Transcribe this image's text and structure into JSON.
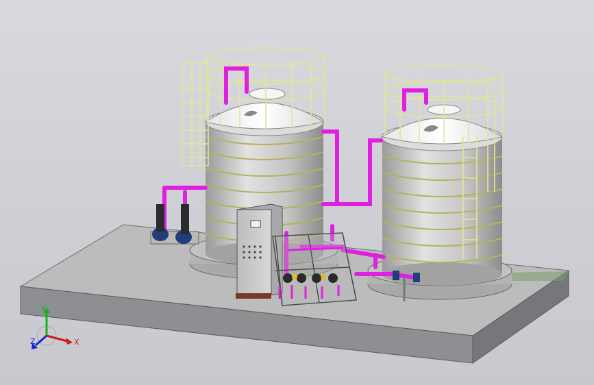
{
  "viewport": {
    "background": "#cfd0d6",
    "model_colors": {
      "slab_top": "#bcbcbc",
      "slab_front": "#8e8f93",
      "slab_side": "#76777b",
      "tank_body": "#c9c9c9",
      "tank_top": "#f1f1f1",
      "tank_band": "#b7b25a",
      "railing": "#ecec9e",
      "pipe": "#e020e0",
      "pump": "#1f3e7a",
      "panel": "#c7c7c9"
    }
  },
  "triad": {
    "x_label": "X",
    "y_label": "Y",
    "z_label": "Z",
    "x_color": "#d01818",
    "y_color": "#18b018",
    "z_color": "#1828d0"
  }
}
